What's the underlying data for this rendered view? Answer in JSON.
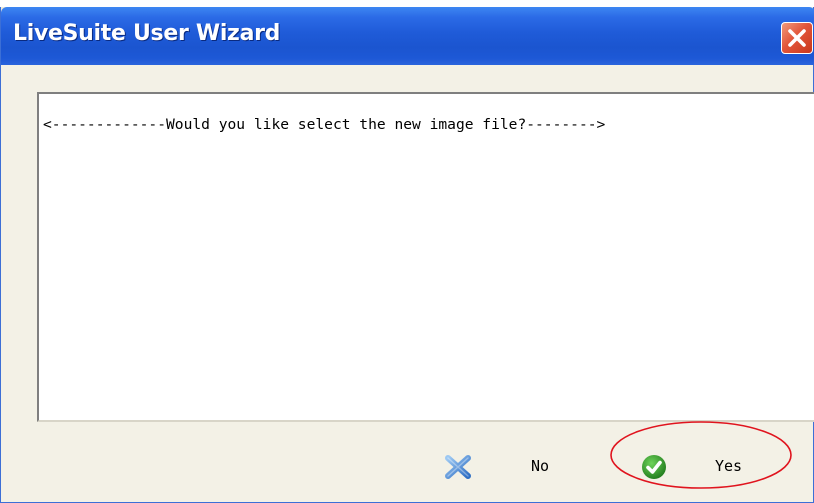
{
  "window": {
    "title": "LiveSuite User Wizard"
  },
  "message": {
    "text": "<-------------Would you like select the new image file?-------->"
  },
  "buttons": {
    "no_label": "No",
    "yes_label": "Yes"
  },
  "icons": {
    "close": "close-icon",
    "no": "x-cross-icon",
    "yes": "green-checkmark-icon"
  },
  "colors": {
    "titlebar": "#1f5bd8",
    "close_button": "#e2563a",
    "dialog_background": "#f3f1e6",
    "highlight_annotation": "#e0141e",
    "yes_icon": "#2e9a2a",
    "no_icon": "#3a7fd0"
  }
}
